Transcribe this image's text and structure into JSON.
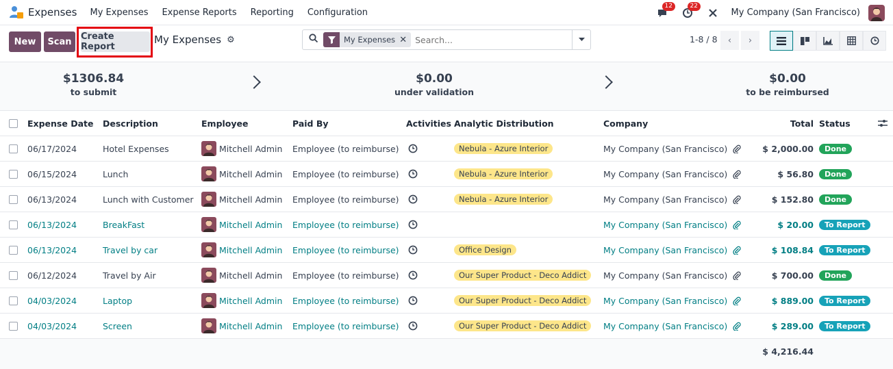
{
  "navbar": {
    "app_title": "Expenses",
    "menu": [
      "My Expenses",
      "Expense Reports",
      "Reporting",
      "Configuration"
    ],
    "messages_count": "12",
    "activities_count": "22",
    "company": "My Company (San Francisco)"
  },
  "control": {
    "new_label": "New",
    "scan_label": "Scan",
    "create_report_label": "Create Report",
    "breadcrumb": "My Expenses",
    "search_facet": "My Expenses",
    "search_placeholder": "Search...",
    "pager": "1-8 / 8"
  },
  "summary": {
    "to_submit_amount": "$1306.84",
    "to_submit_label": "to submit",
    "validation_amount": "$0.00",
    "validation_label": "under validation",
    "reimbursed_amount": "$0.00",
    "reimbursed_label": "to be reimbursed"
  },
  "table": {
    "headers": {
      "date": "Expense Date",
      "description": "Description",
      "employee": "Employee",
      "paid_by": "Paid By",
      "activities": "Activities",
      "analytic": "Analytic Distribution",
      "company": "Company",
      "total": "Total",
      "status": "Status"
    },
    "rows": [
      {
        "date": "06/17/2024",
        "description": "Hotel Expenses",
        "employee": "Mitchell Admin",
        "paid_by": "Employee (to reimburse)",
        "analytic": "Nebula - Azure Interior",
        "company": "My Company (San Francisco)",
        "total": "$ 2,000.00",
        "status": "Done"
      },
      {
        "date": "06/15/2024",
        "description": "Lunch",
        "employee": "Mitchell Admin",
        "paid_by": "Employee (to reimburse)",
        "analytic": "Nebula - Azure Interior",
        "company": "My Company (San Francisco)",
        "total": "$ 56.80",
        "status": "Done"
      },
      {
        "date": "06/13/2024",
        "description": "Lunch with Customer",
        "employee": "Mitchell Admin",
        "paid_by": "Employee (to reimburse)",
        "analytic": "Nebula - Azure Interior",
        "company": "My Company (San Francisco)",
        "total": "$ 152.80",
        "status": "Done"
      },
      {
        "date": "06/13/2024",
        "description": "BreakFast",
        "employee": "Mitchell Admin",
        "paid_by": "Employee (to reimburse)",
        "analytic": "",
        "company": "My Company (San Francisco)",
        "total": "$ 20.00",
        "status": "To Report"
      },
      {
        "date": "06/13/2024",
        "description": "Travel by car",
        "employee": "Mitchell Admin",
        "paid_by": "Employee (to reimburse)",
        "analytic": "Office Design",
        "company": "My Company (San Francisco)",
        "total": "$ 108.84",
        "status": "To Report"
      },
      {
        "date": "06/12/2024",
        "description": "Travel by Air",
        "employee": "Mitchell Admin",
        "paid_by": "Employee (to reimburse)",
        "analytic": "Our Super Product - Deco Addict",
        "company": "My Company (San Francisco)",
        "total": "$ 700.00",
        "status": "Done"
      },
      {
        "date": "04/03/2024",
        "description": "Laptop",
        "employee": "Mitchell Admin",
        "paid_by": "Employee (to reimburse)",
        "analytic": "Our Super Product - Deco Addict",
        "company": "My Company (San Francisco)",
        "total": "$ 889.00",
        "status": "To Report"
      },
      {
        "date": "04/03/2024",
        "description": "Screen",
        "employee": "Mitchell Admin",
        "paid_by": "Employee (to reimburse)",
        "analytic": "Our Super Product - Deco Addict",
        "company": "My Company (San Francisco)",
        "total": "$ 289.00",
        "status": "To Report"
      }
    ],
    "grand_total": "$ 4,216.44"
  },
  "colors": {
    "primary": "#714b67",
    "link": "#017e84",
    "done": "#22a45a",
    "to_report": "#17a2b8",
    "highlight": "#e3000f"
  }
}
